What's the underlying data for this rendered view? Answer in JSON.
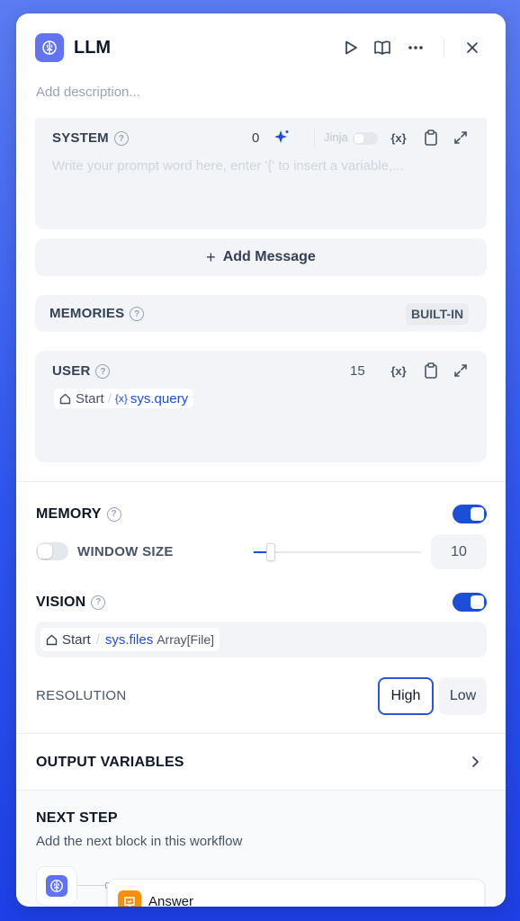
{
  "header": {
    "title": "LLM",
    "description_placeholder": "Add description...",
    "icons": [
      "brain-icon",
      "play-icon",
      "book-icon",
      "more-icon",
      "close-icon"
    ]
  },
  "system": {
    "label": "SYSTEM",
    "token_count": "0",
    "jinja_label": "Jinja",
    "var_icon_text": "{x}",
    "placeholder": "Write your prompt word here, enter '{' to insert a variable,..."
  },
  "add_message": {
    "label": "+ Add Message",
    "text": "Add Message"
  },
  "memories": {
    "label": "MEMORIES",
    "badge": "BUILT-IN"
  },
  "user": {
    "label": "USER",
    "token_count": "15",
    "var_icon_text": "{x}",
    "var_node": "Start",
    "var_sep": "/",
    "var_prefix": "{x}",
    "var_name": "sys.query"
  },
  "memory": {
    "label": "MEMORY",
    "enabled": true,
    "window_size_label": "WINDOW SIZE",
    "window_size_enabled": false,
    "window_size_value": "10",
    "slider_fraction": 0.1
  },
  "vision": {
    "label": "VISION",
    "enabled": true,
    "var_node": "Start",
    "var_sep": "/",
    "var_name": "sys.files",
    "var_type": "Array[File]"
  },
  "resolution": {
    "label": "RESOLUTION",
    "options": [
      "High",
      "Low"
    ],
    "selected": "High"
  },
  "output_variables": {
    "label": "OUTPUT VARIABLES"
  },
  "next_step": {
    "title": "NEXT STEP",
    "subtitle": "Add the next block in this workflow",
    "block_label": "Answer"
  },
  "colors": {
    "accent": "#1d4ed8",
    "llm_badge": "#6172f3",
    "answer_badge": "#f79009",
    "background_gradient_top": "#5b7cf2",
    "background_gradient_bottom": "#1e3fe6"
  }
}
